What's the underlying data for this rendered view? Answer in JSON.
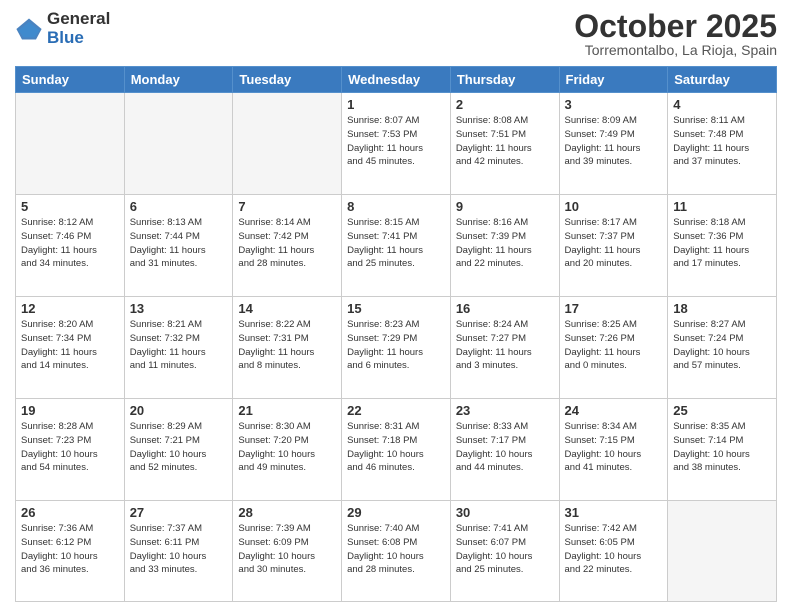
{
  "logo": {
    "general": "General",
    "blue": "Blue"
  },
  "header": {
    "month": "October 2025",
    "location": "Torremontalbo, La Rioja, Spain"
  },
  "days_of_week": [
    "Sunday",
    "Monday",
    "Tuesday",
    "Wednesday",
    "Thursday",
    "Friday",
    "Saturday"
  ],
  "weeks": [
    [
      {
        "day": "",
        "info": ""
      },
      {
        "day": "",
        "info": ""
      },
      {
        "day": "",
        "info": ""
      },
      {
        "day": "1",
        "info": "Sunrise: 8:07 AM\nSunset: 7:53 PM\nDaylight: 11 hours\nand 45 minutes."
      },
      {
        "day": "2",
        "info": "Sunrise: 8:08 AM\nSunset: 7:51 PM\nDaylight: 11 hours\nand 42 minutes."
      },
      {
        "day": "3",
        "info": "Sunrise: 8:09 AM\nSunset: 7:49 PM\nDaylight: 11 hours\nand 39 minutes."
      },
      {
        "day": "4",
        "info": "Sunrise: 8:11 AM\nSunset: 7:48 PM\nDaylight: 11 hours\nand 37 minutes."
      }
    ],
    [
      {
        "day": "5",
        "info": "Sunrise: 8:12 AM\nSunset: 7:46 PM\nDaylight: 11 hours\nand 34 minutes."
      },
      {
        "day": "6",
        "info": "Sunrise: 8:13 AM\nSunset: 7:44 PM\nDaylight: 11 hours\nand 31 minutes."
      },
      {
        "day": "7",
        "info": "Sunrise: 8:14 AM\nSunset: 7:42 PM\nDaylight: 11 hours\nand 28 minutes."
      },
      {
        "day": "8",
        "info": "Sunrise: 8:15 AM\nSunset: 7:41 PM\nDaylight: 11 hours\nand 25 minutes."
      },
      {
        "day": "9",
        "info": "Sunrise: 8:16 AM\nSunset: 7:39 PM\nDaylight: 11 hours\nand 22 minutes."
      },
      {
        "day": "10",
        "info": "Sunrise: 8:17 AM\nSunset: 7:37 PM\nDaylight: 11 hours\nand 20 minutes."
      },
      {
        "day": "11",
        "info": "Sunrise: 8:18 AM\nSunset: 7:36 PM\nDaylight: 11 hours\nand 17 minutes."
      }
    ],
    [
      {
        "day": "12",
        "info": "Sunrise: 8:20 AM\nSunset: 7:34 PM\nDaylight: 11 hours\nand 14 minutes."
      },
      {
        "day": "13",
        "info": "Sunrise: 8:21 AM\nSunset: 7:32 PM\nDaylight: 11 hours\nand 11 minutes."
      },
      {
        "day": "14",
        "info": "Sunrise: 8:22 AM\nSunset: 7:31 PM\nDaylight: 11 hours\nand 8 minutes."
      },
      {
        "day": "15",
        "info": "Sunrise: 8:23 AM\nSunset: 7:29 PM\nDaylight: 11 hours\nand 6 minutes."
      },
      {
        "day": "16",
        "info": "Sunrise: 8:24 AM\nSunset: 7:27 PM\nDaylight: 11 hours\nand 3 minutes."
      },
      {
        "day": "17",
        "info": "Sunrise: 8:25 AM\nSunset: 7:26 PM\nDaylight: 11 hours\nand 0 minutes."
      },
      {
        "day": "18",
        "info": "Sunrise: 8:27 AM\nSunset: 7:24 PM\nDaylight: 10 hours\nand 57 minutes."
      }
    ],
    [
      {
        "day": "19",
        "info": "Sunrise: 8:28 AM\nSunset: 7:23 PM\nDaylight: 10 hours\nand 54 minutes."
      },
      {
        "day": "20",
        "info": "Sunrise: 8:29 AM\nSunset: 7:21 PM\nDaylight: 10 hours\nand 52 minutes."
      },
      {
        "day": "21",
        "info": "Sunrise: 8:30 AM\nSunset: 7:20 PM\nDaylight: 10 hours\nand 49 minutes."
      },
      {
        "day": "22",
        "info": "Sunrise: 8:31 AM\nSunset: 7:18 PM\nDaylight: 10 hours\nand 46 minutes."
      },
      {
        "day": "23",
        "info": "Sunrise: 8:33 AM\nSunset: 7:17 PM\nDaylight: 10 hours\nand 44 minutes."
      },
      {
        "day": "24",
        "info": "Sunrise: 8:34 AM\nSunset: 7:15 PM\nDaylight: 10 hours\nand 41 minutes."
      },
      {
        "day": "25",
        "info": "Sunrise: 8:35 AM\nSunset: 7:14 PM\nDaylight: 10 hours\nand 38 minutes."
      }
    ],
    [
      {
        "day": "26",
        "info": "Sunrise: 7:36 AM\nSunset: 6:12 PM\nDaylight: 10 hours\nand 36 minutes."
      },
      {
        "day": "27",
        "info": "Sunrise: 7:37 AM\nSunset: 6:11 PM\nDaylight: 10 hours\nand 33 minutes."
      },
      {
        "day": "28",
        "info": "Sunrise: 7:39 AM\nSunset: 6:09 PM\nDaylight: 10 hours\nand 30 minutes."
      },
      {
        "day": "29",
        "info": "Sunrise: 7:40 AM\nSunset: 6:08 PM\nDaylight: 10 hours\nand 28 minutes."
      },
      {
        "day": "30",
        "info": "Sunrise: 7:41 AM\nSunset: 6:07 PM\nDaylight: 10 hours\nand 25 minutes."
      },
      {
        "day": "31",
        "info": "Sunrise: 7:42 AM\nSunset: 6:05 PM\nDaylight: 10 hours\nand 22 minutes."
      },
      {
        "day": "",
        "info": ""
      }
    ]
  ]
}
